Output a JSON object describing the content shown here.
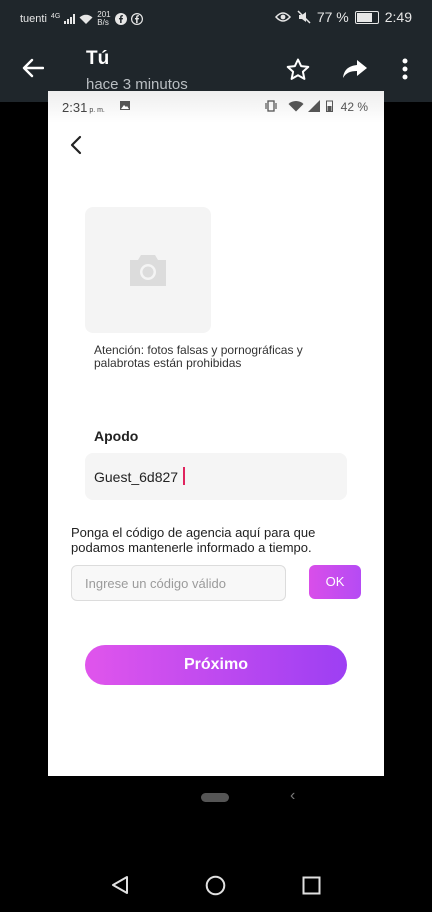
{
  "outer_status": {
    "carrier": "tuenti",
    "net_type": "4G",
    "speed_top": "201",
    "speed_unit": "B/s",
    "battery": "77 %",
    "time": "2:49"
  },
  "outer_bar": {
    "title": "Tú",
    "subtitle": "hace 3 minutos"
  },
  "inner_status": {
    "time": "2:31",
    "ampm": "p. m.",
    "battery": "42 %"
  },
  "form": {
    "warning": "Atención: fotos falsas y pornográficas y palabrotas están prohibidas",
    "nick_label": "Apodo",
    "nick_value": "Guest_6d827",
    "agency_text": "Ponga el código de agencia aquí para que podamos mantenerle informado a tiempo.",
    "code_placeholder": "Ingrese un código válido",
    "ok_label": "OK",
    "next_label": "Próximo"
  },
  "icons": {
    "back": "arrow-left-icon",
    "star": "star-icon",
    "share": "share-icon",
    "more": "more-vert-icon",
    "camera": "camera-icon",
    "inner_back": "chevron-left-icon",
    "nav_back": "triangle-back-icon",
    "nav_home": "circle-home-icon",
    "nav_recent": "square-recent-icon"
  },
  "colors": {
    "outer_bar": "#1f262b",
    "accent_start": "#e055ec",
    "accent_end": "#9d3ff3"
  }
}
